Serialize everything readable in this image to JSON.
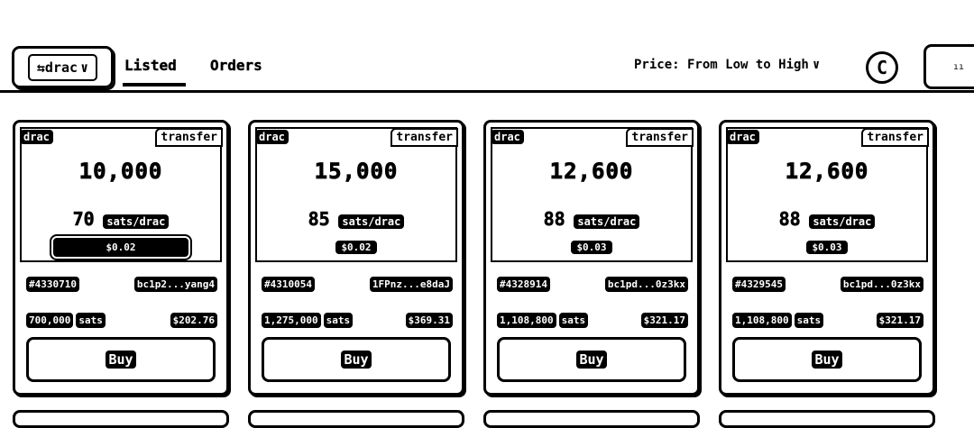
{
  "header": {
    "token_select_label": "⇆drac",
    "tabs": [
      {
        "label": "Listed"
      },
      {
        "label": "Orders"
      }
    ],
    "sort_label": "Price: From Low to High",
    "refresh_icon": "refresh-icon",
    "wallet_label": "ıı"
  },
  "cards": [
    {
      "ticker": "drac",
      "type": "transfer",
      "amount": "10,000",
      "unit_price": "70",
      "unit_label": "sats/drac",
      "unit_usd": "$0.02",
      "inscription": "#4330710",
      "address": "bc1p2...yang4",
      "total_sats": "700,000",
      "sats_label": "sats",
      "total_usd": "$202.76",
      "buy_label": "Buy"
    },
    {
      "ticker": "drac",
      "type": "transfer",
      "amount": "15,000",
      "unit_price": "85",
      "unit_label": "sats/drac",
      "unit_usd": "$0.02",
      "inscription": "#4310054",
      "address": "1FPnz...e8daJ",
      "total_sats": "1,275,000",
      "sats_label": "sats",
      "total_usd": "$369.31",
      "buy_label": "Buy"
    },
    {
      "ticker": "drac",
      "type": "transfer",
      "amount": "12,600",
      "unit_price": "88",
      "unit_label": "sats/drac",
      "unit_usd": "$0.03",
      "inscription": "#4328914",
      "address": "bc1pd...0z3kx",
      "total_sats": "1,108,800",
      "sats_label": "sats",
      "total_usd": "$321.17",
      "buy_label": "Buy"
    },
    {
      "ticker": "drac",
      "type": "transfer",
      "amount": "12,600",
      "unit_price": "88",
      "unit_label": "sats/drac",
      "unit_usd": "$0.03",
      "inscription": "#4329545",
      "address": "bc1pd...0z3kx",
      "total_sats": "1,108,800",
      "sats_label": "sats",
      "total_usd": "$321.17",
      "buy_label": "Buy"
    }
  ]
}
